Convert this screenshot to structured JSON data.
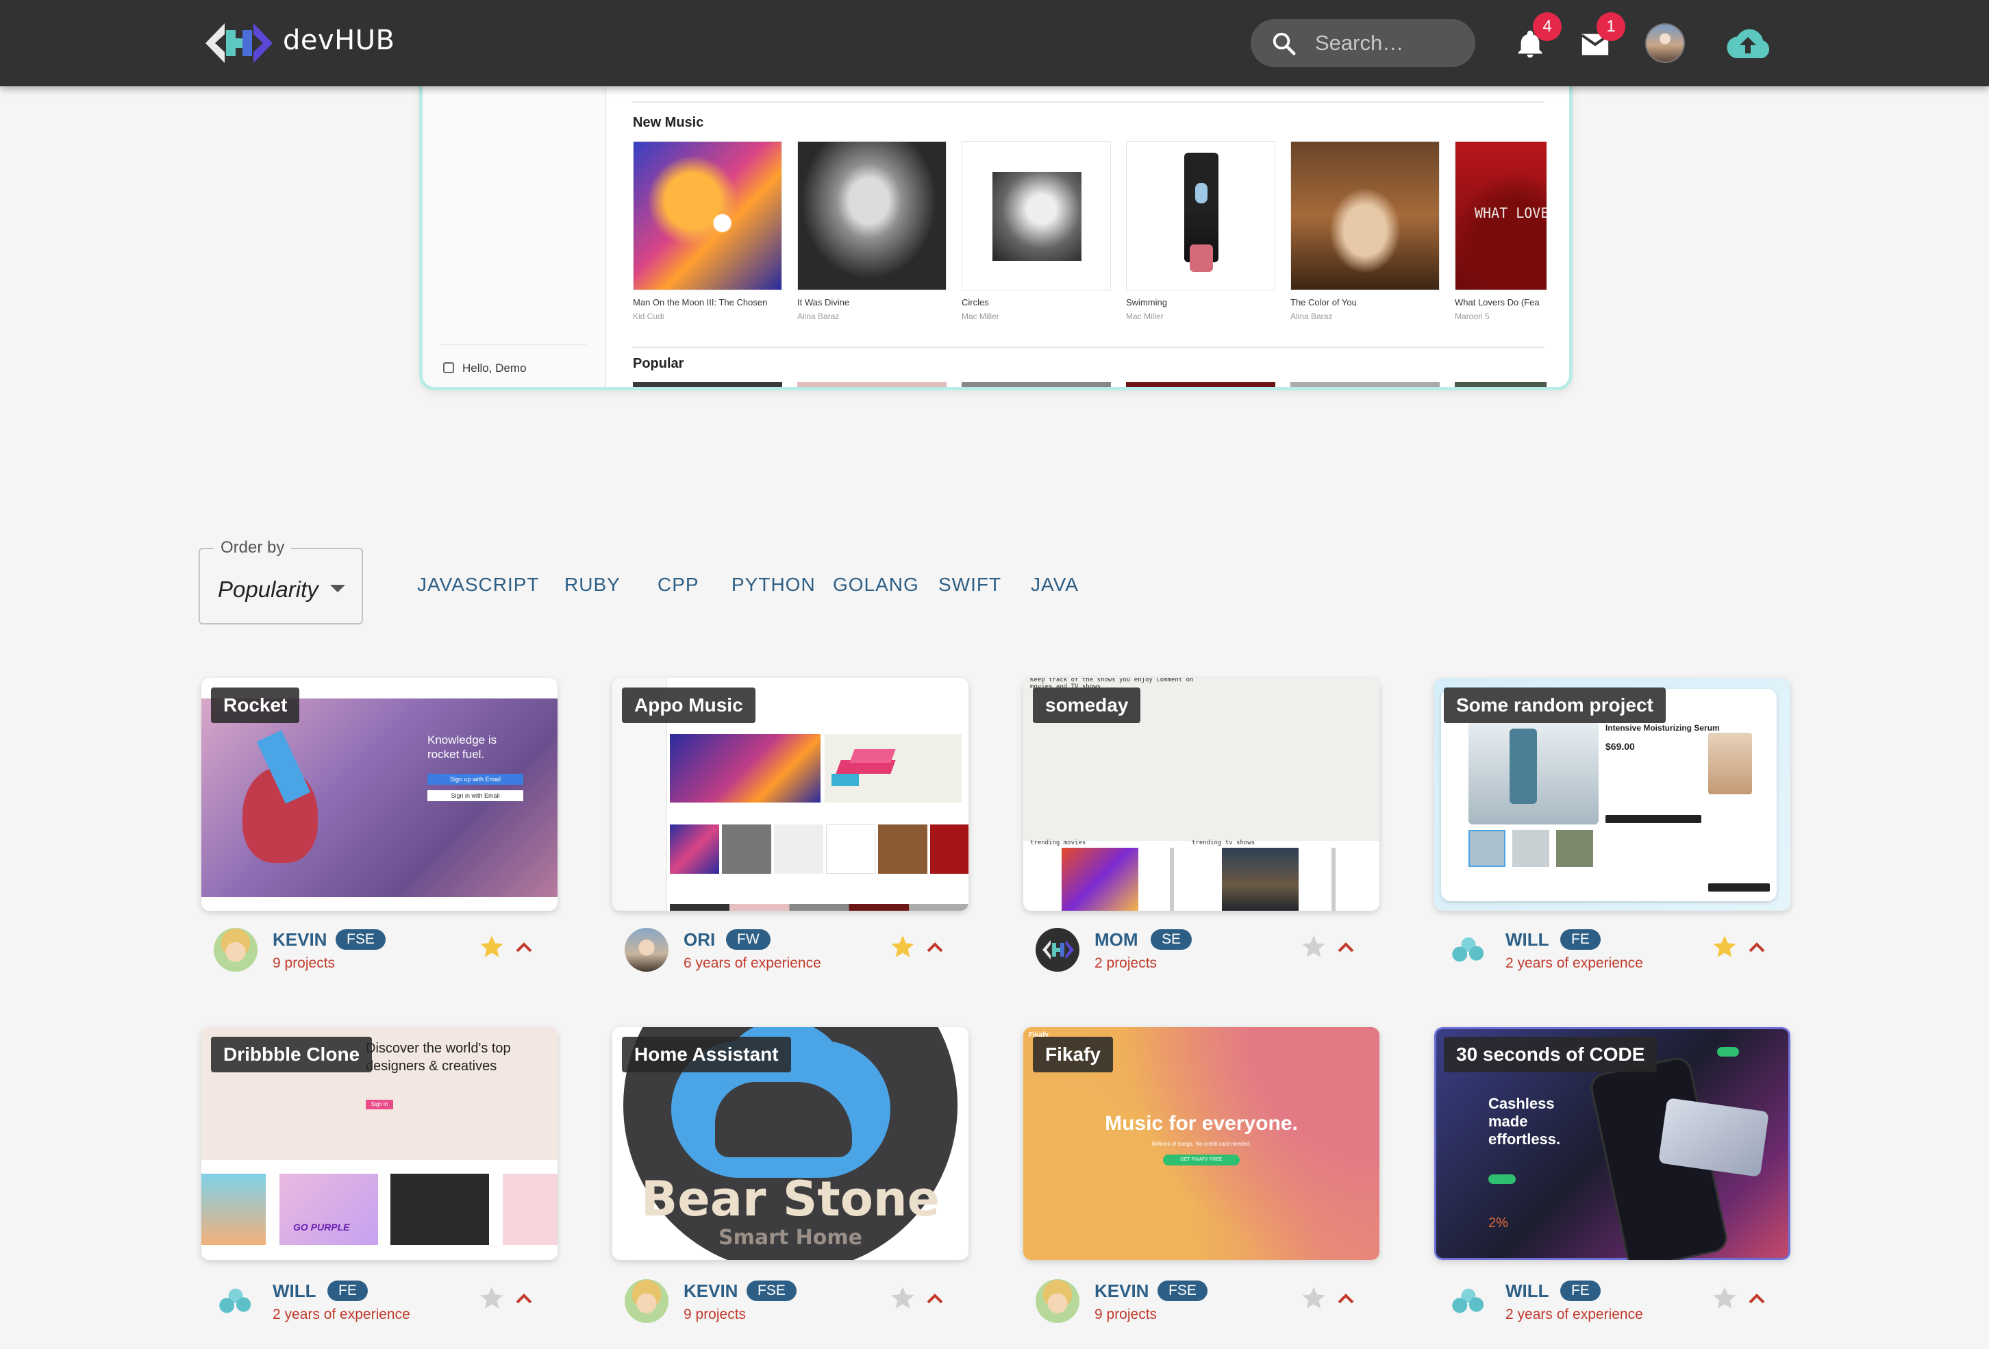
{
  "header": {
    "brand": "devHUB",
    "search_placeholder": "Search…",
    "notifications_count": "4",
    "messages_count": "1",
    "colors": {
      "bar": "#323232",
      "accent": "#2d5f86",
      "upload": "#5cc8c0",
      "badge": "#e5284a"
    }
  },
  "preview": {
    "section_new": "New Music",
    "section_popular": "Popular",
    "user_greeting": "Hello, Demo",
    "albums": [
      {
        "title": "Man On the Moon III: The Chosen",
        "artist": "Kid Cudi"
      },
      {
        "title": "It Was Divine",
        "artist": "Alina Baraz"
      },
      {
        "title": "Circles",
        "artist": "Mac Miller"
      },
      {
        "title": "Swimming",
        "artist": "Mac Miller"
      },
      {
        "title": "The Color of You",
        "artist": "Alina Baraz"
      },
      {
        "title": "What Lovers Do (Fea",
        "artist": "Maroon 5"
      }
    ]
  },
  "filters": {
    "order_label": "Order by",
    "order_value": "Popularity",
    "languages": [
      "JAVASCRIPT",
      "RUBY",
      "CPP",
      "PYTHON",
      "GOLANG",
      "SWIFT",
      "JAVA"
    ]
  },
  "projects": [
    {
      "title": "Rocket",
      "author": "KEVIN",
      "role": "FSE",
      "sub": "9 projects",
      "starred": true
    },
    {
      "title": "Appo Music",
      "author": "ORI",
      "role": "FW",
      "sub": "6 years of experience",
      "starred": true
    },
    {
      "title": "someday",
      "author": "MOM",
      "role": "SE",
      "sub": "2 projects",
      "starred": false
    },
    {
      "title": "Some random project",
      "author": "WILL",
      "role": "FE",
      "sub": "2 years of experience",
      "starred": true
    },
    {
      "title": "Dribbble Clone",
      "author": "WILL",
      "role": "FE",
      "sub": "2 years of experience",
      "starred": false
    },
    {
      "title": "Home Assistant",
      "author": "KEVIN",
      "role": "FSE",
      "sub": "9 projects",
      "starred": false
    },
    {
      "title": "Fikafy",
      "author": "KEVIN",
      "role": "FSE",
      "sub": "9 projects",
      "starred": false
    },
    {
      "title": "30 seconds of CODE",
      "author": "WILL",
      "role": "FE",
      "sub": "2 years of experience",
      "starred": false
    }
  ],
  "shot_text": {
    "rocket": "Knowledge is rocket fuel.",
    "rocket_btn1": "Sign up with Email",
    "rocket_btn2": "Sign in with Email",
    "someday": "Keep track of the shows you enjoy Comment on movies and TV shows",
    "someday_l1": "trending movies",
    "someday_l2": "trending tv shows",
    "random_title": "Intensive Moisturizing Serum",
    "random_price": "$69.00",
    "dribbble": "Discover the world's top designers & creatives",
    "dribbble_btn": "Sign in",
    "dribbble_purple": "GO PURPLE",
    "bear_big": "Bear Stone",
    "bear_small": "Smart Home",
    "fikafy_logo": "Fikafy",
    "fikafy_big": "Music for everyone.",
    "fikafy_sub": "Millions of songs. No credit card needed.",
    "fikafy_btn": "GET FIKAFY FREE",
    "code_head": "Cashless made effortless.",
    "code_pct": "2%",
    "album_wl": "WHAT LOVE"
  }
}
